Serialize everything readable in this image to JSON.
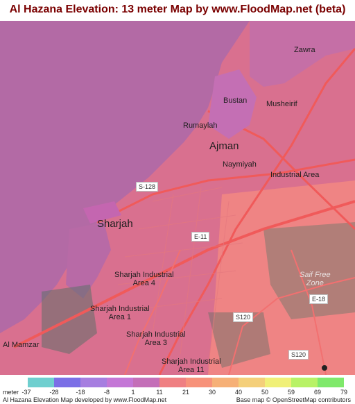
{
  "title": "Al Hazana Elevation: 13 meter Map by www.FloodMap.net (beta)",
  "places": [
    {
      "name": "zawra",
      "text": "Zawra",
      "size": "small"
    },
    {
      "name": "bustan",
      "text": "Bustan",
      "size": "small"
    },
    {
      "name": "musheirif",
      "text": "Musheirif",
      "size": "small"
    },
    {
      "name": "rumaylah",
      "text": "Rumaylah",
      "size": "small"
    },
    {
      "name": "ajman",
      "text": "Ajman",
      "size": "large"
    },
    {
      "name": "naymiyah",
      "text": "Naymiyah",
      "size": "small"
    },
    {
      "name": "industrial-area",
      "text": "Industrial Area",
      "size": "small"
    },
    {
      "name": "sharjah",
      "text": "Sharjah",
      "size": "large"
    },
    {
      "name": "sharjah-industrial-area-4",
      "text": "Sharjah Industrial\nArea 4",
      "size": "small"
    },
    {
      "name": "sharjah-industrial-area-1",
      "text": "Sharjah Industrial\nArea 1",
      "size": "small"
    },
    {
      "name": "sharjah-industrial-area-3",
      "text": "Sharjah Industrial\nArea 3",
      "size": "small"
    },
    {
      "name": "sharjah-industrial-area-11",
      "text": "Sharjah Industrial\nArea 11",
      "size": "small"
    },
    {
      "name": "al-mamzar",
      "text": "Al Mamzar",
      "size": "small"
    },
    {
      "name": "free-zone",
      "text": "Saif Free\nZone",
      "size": "small"
    }
  ],
  "road_shields": [
    "S-128",
    "E-11",
    "S120",
    "S120",
    "E-18"
  ],
  "legend": {
    "unit": "meter",
    "ticks": [
      "-37",
      "-28",
      "-18",
      "-8",
      "1",
      "11",
      "21",
      "30",
      "40",
      "50",
      "59",
      "69",
      "79"
    ],
    "colors": [
      "#6fcfcf",
      "#7b6fe6",
      "#a67ee0",
      "#c477d6",
      "#c46fb8",
      "#ef7f82",
      "#f7927a",
      "#f6b077",
      "#f4cf7a",
      "#f0f078",
      "#b8f266",
      "#7fe96b"
    ]
  },
  "footer": {
    "left": "Al Hazana Elevation Map developed by www.FloodMap.net",
    "right": "Base map © OpenStreetMap contributors"
  }
}
